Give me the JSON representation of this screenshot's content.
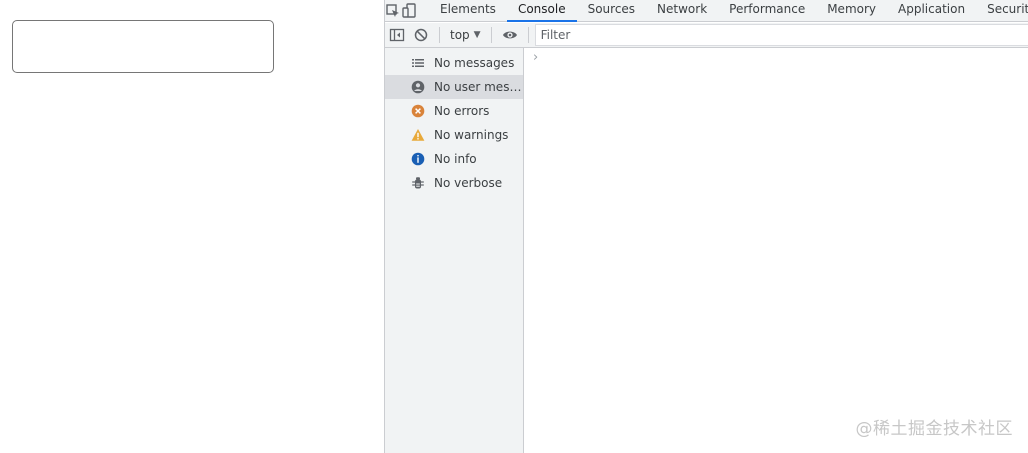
{
  "devtools": {
    "tabs": [
      "Elements",
      "Console",
      "Sources",
      "Network",
      "Performance",
      "Memory",
      "Application",
      "Security"
    ],
    "active_tab": "Console",
    "toolbar": {
      "context": "top",
      "filter_placeholder": "Filter"
    },
    "sidebar": {
      "items": [
        {
          "label": "No messages",
          "icon": "list-icon"
        },
        {
          "label": "No user messa…",
          "icon": "user-icon"
        },
        {
          "label": "No errors",
          "icon": "error-icon"
        },
        {
          "label": "No warnings",
          "icon": "warning-icon"
        },
        {
          "label": "No info",
          "icon": "info-icon"
        },
        {
          "label": "No verbose",
          "icon": "bug-icon"
        }
      ],
      "selected_index": 1
    },
    "console": {
      "prompt": "›"
    }
  },
  "watermark": "@稀土掘金技术社区",
  "colors": {
    "accent": "#1a73e8",
    "error": "#d9833a",
    "warning": "#e8a93a",
    "info": "#1a73e8"
  }
}
